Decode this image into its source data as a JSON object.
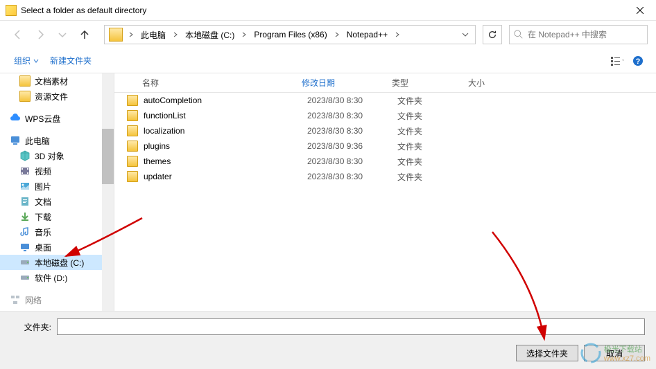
{
  "title": "Select a folder as default directory",
  "breadcrumb": {
    "items": [
      "此电脑",
      "本地磁盘 (C:)",
      "Program Files (x86)",
      "Notepad++"
    ]
  },
  "search": {
    "placeholder": "在 Notepad++ 中搜索"
  },
  "toolbar": {
    "organize": "组织",
    "new_folder": "新建文件夹"
  },
  "sidebar": {
    "items": [
      {
        "label": "文档素材",
        "icon": "folder"
      },
      {
        "label": "资源文件",
        "icon": "folder"
      }
    ],
    "wps": "WPS云盘",
    "thispc": "此电脑",
    "thispc_items": [
      {
        "label": "3D 对象",
        "icon": "cube"
      },
      {
        "label": "视频",
        "icon": "film"
      },
      {
        "label": "图片",
        "icon": "image"
      },
      {
        "label": "文档",
        "icon": "doc"
      },
      {
        "label": "下载",
        "icon": "download"
      },
      {
        "label": "音乐",
        "icon": "music"
      },
      {
        "label": "桌面",
        "icon": "desktop"
      },
      {
        "label": "本地磁盘 (C:)",
        "icon": "disk",
        "selected": true
      },
      {
        "label": "软件 (D:)",
        "icon": "disk"
      }
    ]
  },
  "columns": {
    "name": "名称",
    "date": "修改日期",
    "type": "类型",
    "size": "大小"
  },
  "files": [
    {
      "name": "autoCompletion",
      "date": "2023/8/30 8:30",
      "type": "文件夹"
    },
    {
      "name": "functionList",
      "date": "2023/8/30 8:30",
      "type": "文件夹"
    },
    {
      "name": "localization",
      "date": "2023/8/30 8:30",
      "type": "文件夹"
    },
    {
      "name": "plugins",
      "date": "2023/8/30 9:36",
      "type": "文件夹"
    },
    {
      "name": "themes",
      "date": "2023/8/30 8:30",
      "type": "文件夹"
    },
    {
      "name": "updater",
      "date": "2023/8/30 8:30",
      "type": "文件夹"
    }
  ],
  "bottom": {
    "folder_label": "文件夹:",
    "select_button": "选择文件夹",
    "cancel_button": "取消"
  },
  "watermark": {
    "text1": "极光下载站",
    "text2": "www.xz7.com"
  }
}
